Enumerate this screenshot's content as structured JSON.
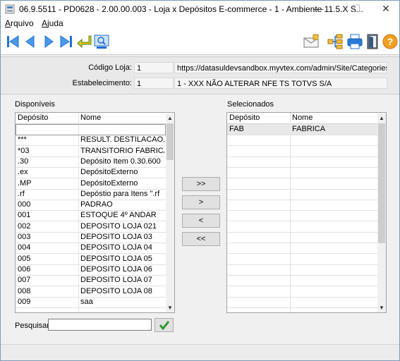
{
  "window": {
    "title": "06.9.5511 - PD0628 - 2.00.00.003 - Loja x Depósitos E-commerce - 1 - Ambiente 11.5.X S...",
    "minimize": "—",
    "maximize": "☐",
    "close": "✕"
  },
  "menu": {
    "arquivo_first": "A",
    "arquivo_rest": "rquivo",
    "ajuda_first": "A",
    "ajuda_rest": "juda"
  },
  "toolbar": {
    "left_icons": [
      "first-record-icon",
      "previous-record-icon",
      "next-record-icon",
      "last-record-icon",
      "return-icon",
      "zoom-icon"
    ],
    "right_icons": [
      "email-icon",
      "hierarchy-icon",
      "print-icon",
      "exit-icon",
      "help-icon"
    ]
  },
  "header": {
    "codigo_loja_label": "Código Loja:",
    "codigo_loja_value": "1",
    "codigo_loja_url": "https://datasuldevsandbox.myvtex.com/admin/Site/Categories.aspx",
    "estabelecimento_label": "Estabelecimento:",
    "estabelecimento_value": "1",
    "estabelecimento_desc": "1 - XXX NÃO ALTERAR NFE TS TOTVS S/A"
  },
  "disponiveis": {
    "label": "Disponíveis",
    "col_deposito": "Depósito",
    "col_nome": "Nome",
    "rows": [
      {
        "deposito": "",
        "nome": ""
      },
      {
        "deposito": "***",
        "nome": "RESULT. DESTILACAO,"
      },
      {
        "deposito": "*03",
        "nome": "TRANSITORIO FABRICA"
      },
      {
        "deposito": ".30",
        "nome": "Depósito Item 0.30.600"
      },
      {
        "deposito": ".ex",
        "nome": "DepósitoExterno"
      },
      {
        "deposito": ".MP",
        "nome": "DepósitoExterno"
      },
      {
        "deposito": ".rf",
        "nome": "Depóstio para Itens \".rf"
      },
      {
        "deposito": "000",
        "nome": "PADRAO"
      },
      {
        "deposito": "001",
        "nome": "ESTOQUE 4º ANDAR"
      },
      {
        "deposito": "002",
        "nome": "DEPOSITO LOJA 021"
      },
      {
        "deposito": "003",
        "nome": "DEPOSITO LOJA 03"
      },
      {
        "deposito": "004",
        "nome": "DEPOSITO LOJA 04"
      },
      {
        "deposito": "005",
        "nome": "DEPOSITO LOJA 05"
      },
      {
        "deposito": "006",
        "nome": "DEPOSITO LOJA 06"
      },
      {
        "deposito": "007",
        "nome": "DEPOSITO LOJA 07"
      },
      {
        "deposito": "008",
        "nome": "DEPOSITO LOJA 08"
      },
      {
        "deposito": "009",
        "nome": "saa"
      }
    ]
  },
  "selecionados": {
    "label": "Selecionados",
    "col_deposito": "Depósito",
    "col_nome": "Nome",
    "rows": [
      {
        "deposito": "FAB",
        "nome": "FABRICA"
      }
    ]
  },
  "move_buttons": {
    "add_all": ">>",
    "add": ">",
    "remove": "<",
    "remove_all": "<<"
  },
  "search": {
    "label": "Pesquisar:",
    "value": ""
  },
  "colors": {
    "selected_row": "#e8e8e8",
    "blue_nav": "#1e6fd9",
    "ok_check": "#2a9a2a"
  }
}
